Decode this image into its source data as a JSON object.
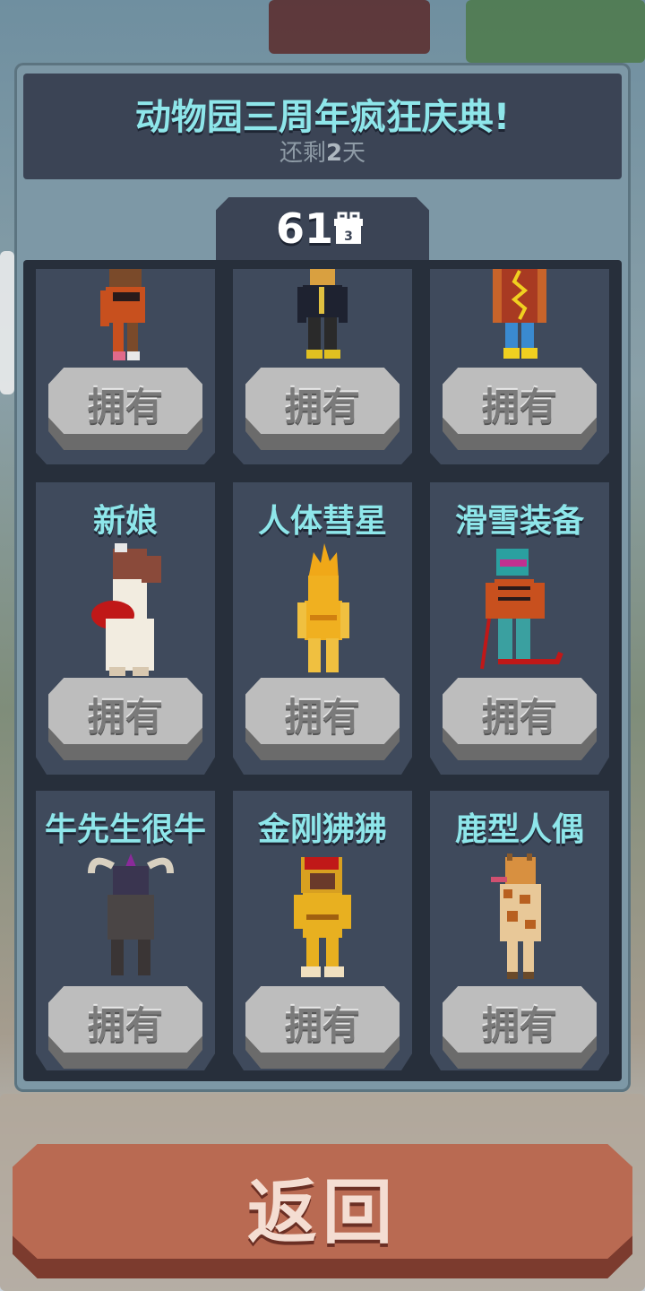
{
  "header": {
    "title": "动物园三周年疯狂庆典!",
    "remaining_prefix": "还剩",
    "remaining_days": "2",
    "remaining_suffix": "天"
  },
  "counter": {
    "value": "61",
    "gift_badge": "3"
  },
  "cards": [
    {
      "name": "",
      "button": "拥有",
      "icon": "striped-character-icon"
    },
    {
      "name": "",
      "button": "拥有",
      "icon": "hoodie-character-icon"
    },
    {
      "name": "",
      "button": "拥有",
      "icon": "hotdog-character-icon"
    },
    {
      "name": "新娘",
      "button": "拥有",
      "icon": "bride-character-icon"
    },
    {
      "name": "人体彗星",
      "button": "拥有",
      "icon": "comet-character-icon"
    },
    {
      "name": "滑雪装备",
      "button": "拥有",
      "icon": "ski-character-icon"
    },
    {
      "name": "牛先生很牛",
      "button": "拥有",
      "icon": "buffalo-character-icon"
    },
    {
      "name": "金刚狒狒",
      "button": "拥有",
      "icon": "monkey-character-icon"
    },
    {
      "name": "鹿型人偶",
      "button": "拥有",
      "icon": "giraffe-character-icon"
    }
  ],
  "back_button": "返回",
  "colors": {
    "title": "#8ee6ea",
    "panel": "#7d98a6",
    "card": "#3f4a5c",
    "back_button": "#b96a52"
  }
}
